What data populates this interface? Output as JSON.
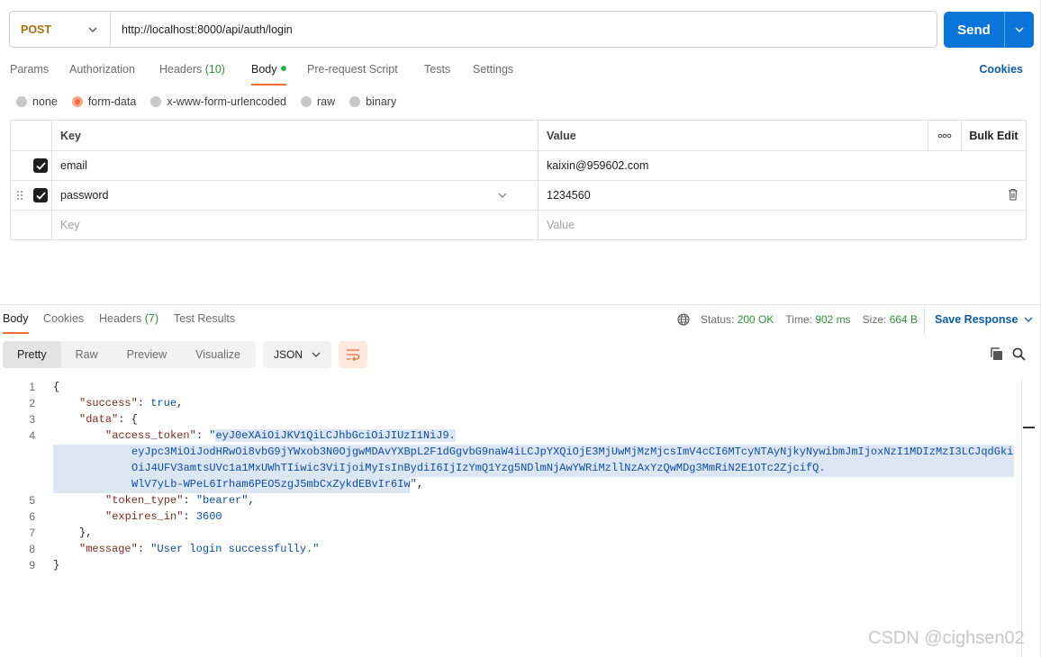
{
  "request": {
    "method": "POST",
    "url": "http://localhost:8000/api/auth/login",
    "send_label": "Send"
  },
  "request_tabs": {
    "params": "Params",
    "authorization": "Authorization",
    "headers": "Headers",
    "headers_count": "(10)",
    "body": "Body",
    "prerequest": "Pre-request Script",
    "tests": "Tests",
    "settings": "Settings",
    "cookies": "Cookies"
  },
  "body_types": [
    "none",
    "form-data",
    "x-www-form-urlencoded",
    "raw",
    "binary"
  ],
  "body_type_selected": "form-data",
  "form_table": {
    "key_header": "Key",
    "value_header": "Value",
    "bulk_edit": "Bulk Edit",
    "rows": [
      {
        "key": "email",
        "value": "kaixin@959602.com",
        "checked": true
      },
      {
        "key": "password",
        "value": "1234560",
        "checked": true
      }
    ],
    "key_placeholder": "Key",
    "value_placeholder": "Value"
  },
  "response_tabs": {
    "body": "Body",
    "cookies": "Cookies",
    "headers": "Headers",
    "headers_count": "(7)",
    "test_results": "Test Results"
  },
  "response_status": {
    "status_label": "Status:",
    "status_value": "200 OK",
    "time_label": "Time:",
    "time_value": "902 ms",
    "size_label": "Size:",
    "size_value": "664 B",
    "save_response": "Save Response"
  },
  "view_modes": [
    "Pretty",
    "Raw",
    "Preview",
    "Visualize"
  ],
  "view_selected": "Pretty",
  "format": "JSON",
  "code": {
    "line_numbers": [
      "1",
      "2",
      "3",
      "4",
      "5",
      "6",
      "7",
      "8",
      "9"
    ],
    "key_success": "\"success\"",
    "val_success": "true",
    "key_data": "\"data\"",
    "key_access_token": "\"access_token\"",
    "token_line1": "eyJ0eXAiOiJKV1QiLCJhbGciOiJIUzI1NiJ9.",
    "token_line2": "eyJpc3MiOiJodHRwOi8vbG9jYWxob3N0OjgwMDAvYXBpL2F1dGgvbG9naW4iLCJpYXQiOjE3MjUwMjMzMjcsImV4cCI6MTcyNTAyNjkyNywibmJmIjoxNzI1MDIzMzI3LCJqdGki",
    "token_line3": "OiJ4UFV3amtsUVc1a1MxUWhTIiwic3ViIjoiMyIsInBydiI6IjIzYmQ1Yzg5NDlmNjAwYWRiMzllNzAxYzQwMDg3MmRiN2E1OTc2ZjcifQ.",
    "token_line4": "WlV7yLb-WPeL6Irham6PEO5zgJ5mbCxZykdEBvIr6Iw",
    "key_token_type": "\"token_type\"",
    "val_token_type": "\"bearer\"",
    "key_expires_in": "\"expires_in\"",
    "val_expires_in": "3600",
    "key_message": "\"message\"",
    "val_message": "\"User login successfully.\""
  },
  "watermark": "CSDN @cighsen02"
}
